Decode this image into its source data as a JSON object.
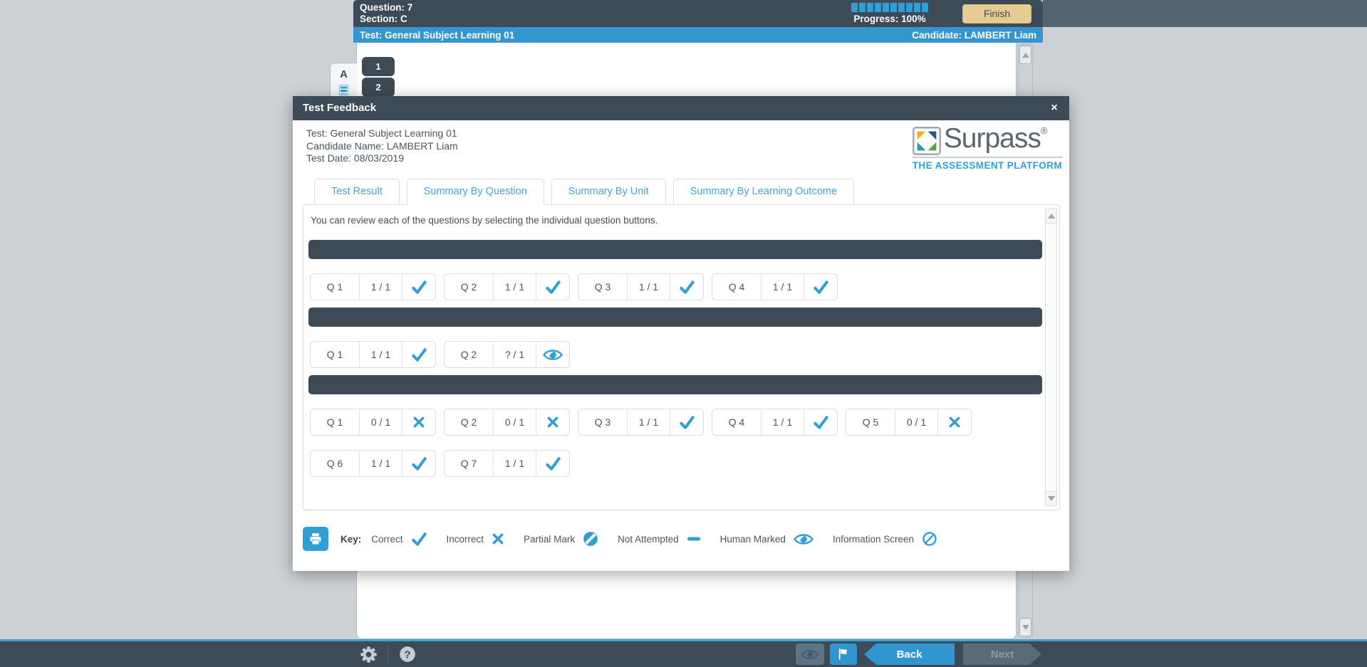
{
  "colors": {
    "accent": "#2f9fd6",
    "dark": "#3d4b56",
    "blue_bar": "#3595ce",
    "tab_text": "#48a4da",
    "finish_bg": "#e7cc92",
    "page_bg": "#cdd2d6",
    "icon_light": "#c5ccd2"
  },
  "top_bar": {
    "question_label": "Question: 7",
    "section_label": "Section: C",
    "progress_label": "Progress: 100%",
    "progress_segments": 10,
    "finish_button": "Finish"
  },
  "sub_bar": {
    "test_label": "Test: General Subject Learning 01",
    "candidate_label": "Candidate: LAMBERT Liam"
  },
  "background_page": {
    "section_tab": "A",
    "question_nav": [
      "1",
      "2"
    ]
  },
  "modal": {
    "title": "Test Feedback",
    "close_label": "×",
    "info": {
      "test": "Test: General Subject Learning 01",
      "candidate": "Candidate Name: LAMBERT Liam",
      "date": "Test Date: 08/03/2019"
    },
    "logo": {
      "name": "Surpass",
      "reg": "®",
      "tagline": "THE ASSESSMENT PLATFORM"
    },
    "tabs": [
      {
        "label": "Test Result",
        "active": false
      },
      {
        "label": "Summary By Question",
        "active": true
      },
      {
        "label": "Summary By Unit",
        "active": false
      },
      {
        "label": "Summary By Learning Outcome",
        "active": false
      }
    ],
    "instruction": "You can review each of the questions by selecting the individual question buttons.",
    "sections": [
      {
        "questions": [
          {
            "label": "Q 1",
            "score": "1 / 1",
            "icon": "correct"
          },
          {
            "label": "Q 2",
            "score": "1 / 1",
            "icon": "correct"
          },
          {
            "label": "Q 3",
            "score": "1 / 1",
            "icon": "correct"
          },
          {
            "label": "Q 4",
            "score": "1 / 1",
            "icon": "correct"
          }
        ]
      },
      {
        "questions": [
          {
            "label": "Q 1",
            "score": "1 / 1",
            "icon": "correct"
          },
          {
            "label": "Q 2",
            "score": "? / 1",
            "icon": "human-marked"
          }
        ]
      },
      {
        "questions": [
          {
            "label": "Q 1",
            "score": "0 / 1",
            "icon": "incorrect"
          },
          {
            "label": "Q 2",
            "score": "0 / 1",
            "icon": "incorrect"
          },
          {
            "label": "Q 3",
            "score": "1 / 1",
            "icon": "correct"
          },
          {
            "label": "Q 4",
            "score": "1 / 1",
            "icon": "correct"
          },
          {
            "label": "Q 5",
            "score": "0 / 1",
            "icon": "incorrect"
          },
          {
            "label": "Q 6",
            "score": "1 / 1",
            "icon": "correct"
          },
          {
            "label": "Q 7",
            "score": "1 / 1",
            "icon": "correct"
          }
        ]
      }
    ],
    "key": {
      "label": "Key:",
      "items": [
        {
          "label": "Correct",
          "icon": "correct"
        },
        {
          "label": "Incorrect",
          "icon": "incorrect"
        },
        {
          "label": "Partial Mark",
          "icon": "partial"
        },
        {
          "label": "Not Attempted",
          "icon": "not-attempted"
        },
        {
          "label": "Human Marked",
          "icon": "human-marked"
        },
        {
          "label": "Information Screen",
          "icon": "information"
        }
      ]
    }
  },
  "footer": {
    "back_label": "Back",
    "next_label": "Next"
  }
}
